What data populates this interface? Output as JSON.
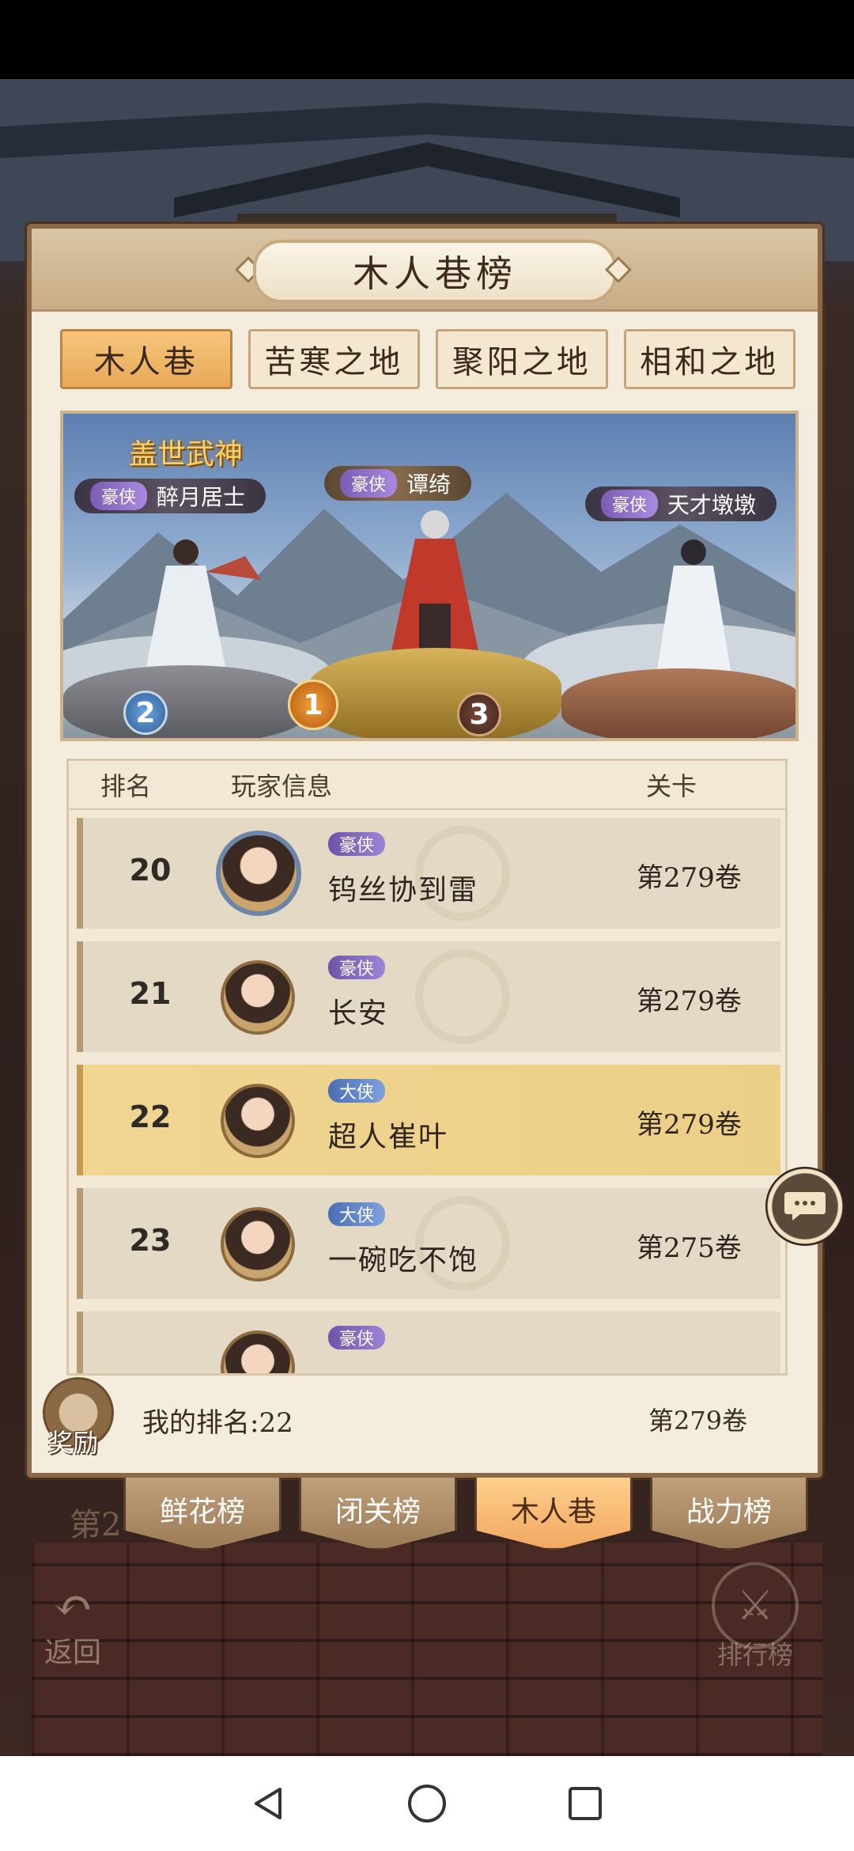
{
  "panel": {
    "title": "木人巷榜"
  },
  "tabs": [
    {
      "label": "木人巷",
      "active": true
    },
    {
      "label": "苦寒之地",
      "active": false
    },
    {
      "label": "聚阳之地",
      "active": false
    },
    {
      "label": "相和之地",
      "active": false
    }
  ],
  "podium": {
    "crown_title": "盖世武神",
    "first": {
      "tag": "豪侠",
      "name": "谭绮",
      "rank": "1"
    },
    "second": {
      "tag": "豪侠",
      "name": "醉月居士",
      "rank": "2"
    },
    "third": {
      "tag": "豪侠",
      "name": "天才墩墩",
      "rank": "3"
    }
  },
  "table": {
    "headers": {
      "rank": "排名",
      "player": "玩家信息",
      "stage": "关卡"
    },
    "rows": [
      {
        "rank": "20",
        "tag": "豪侠",
        "name": "钨丝协到雷",
        "stage": "第279卷"
      },
      {
        "rank": "21",
        "tag": "豪侠",
        "name": "长安",
        "stage": "第279卷"
      },
      {
        "rank": "22",
        "tag": "大侠",
        "name": "超人崔叶",
        "stage": "第279卷",
        "mine": true
      },
      {
        "rank": "23",
        "tag": "大侠",
        "name": "一碗吃不饱",
        "stage": "第275卷"
      },
      {
        "rank": "",
        "tag": "豪侠",
        "name": "",
        "stage": ""
      }
    ]
  },
  "my_rank": {
    "reward_label": "奖励",
    "text": "我的排名:22",
    "stage": "第279卷"
  },
  "bottom_tabs": [
    {
      "label": "鲜花榜",
      "active": false
    },
    {
      "label": "闭关榜",
      "active": false
    },
    {
      "label": "木人巷",
      "active": true
    },
    {
      "label": "战力榜",
      "active": false
    }
  ],
  "background_text": "第2",
  "back_button": {
    "label": "返回"
  },
  "ranking_button": {
    "label": "排行榜"
  },
  "icons": {
    "chat": "chat-bubble-icon",
    "back": "back-arrow-icon",
    "ranking": "crossed-swords-icon",
    "nav_back": "triangle-back-icon",
    "nav_home": "circle-home-icon",
    "nav_recent": "square-recent-icon"
  },
  "colors": {
    "accent": "#e9a858",
    "mine_row": "#eccf86",
    "panel_bg": "#f4eddd"
  }
}
